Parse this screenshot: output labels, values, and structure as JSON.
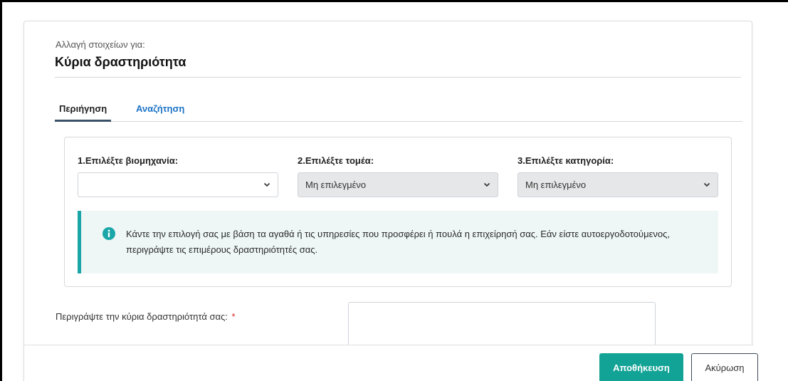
{
  "header": {
    "eyebrow": "Αλλαγή στοιχείων για:",
    "title": "Κύρια δραστηριότητα"
  },
  "tabs": [
    {
      "label": "Περιήγηση",
      "active": true
    },
    {
      "label": "Αναζήτηση",
      "active": false
    }
  ],
  "fields": [
    {
      "label": "1.Επιλέξτε βιομηχανία:",
      "value": "",
      "disabled": false
    },
    {
      "label": "2.Επιλέξτε τομέα:",
      "value": "Μη επιλεγμένο",
      "disabled": true
    },
    {
      "label": "3.Επιλέξτε κατηγορία:",
      "value": "Μη επιλεγμένο",
      "disabled": true
    }
  ],
  "info": {
    "icon": "info-circle-icon",
    "text": "Κάντε την επιλογή σας με βάση τα αγαθά ή τις υπηρεσίες που προσφέρει ή πουλά η επιχείρησή σας. Εάν είστε αυτοεργοδοτούμενος, περιγράψτε τις επιμέρους δραστηριότητές σας."
  },
  "description": {
    "label": "Περιγράψτε την κύρια δραστηριότητά σας:",
    "required_mark": "*",
    "value": ""
  },
  "footer": {
    "save_label": "Αποθήκευση",
    "cancel_label": "Ακύρωση"
  },
  "colors": {
    "accent": "#13a396",
    "link": "#1b73c6",
    "info": "#1aa6a8",
    "required": "#d9242a"
  }
}
